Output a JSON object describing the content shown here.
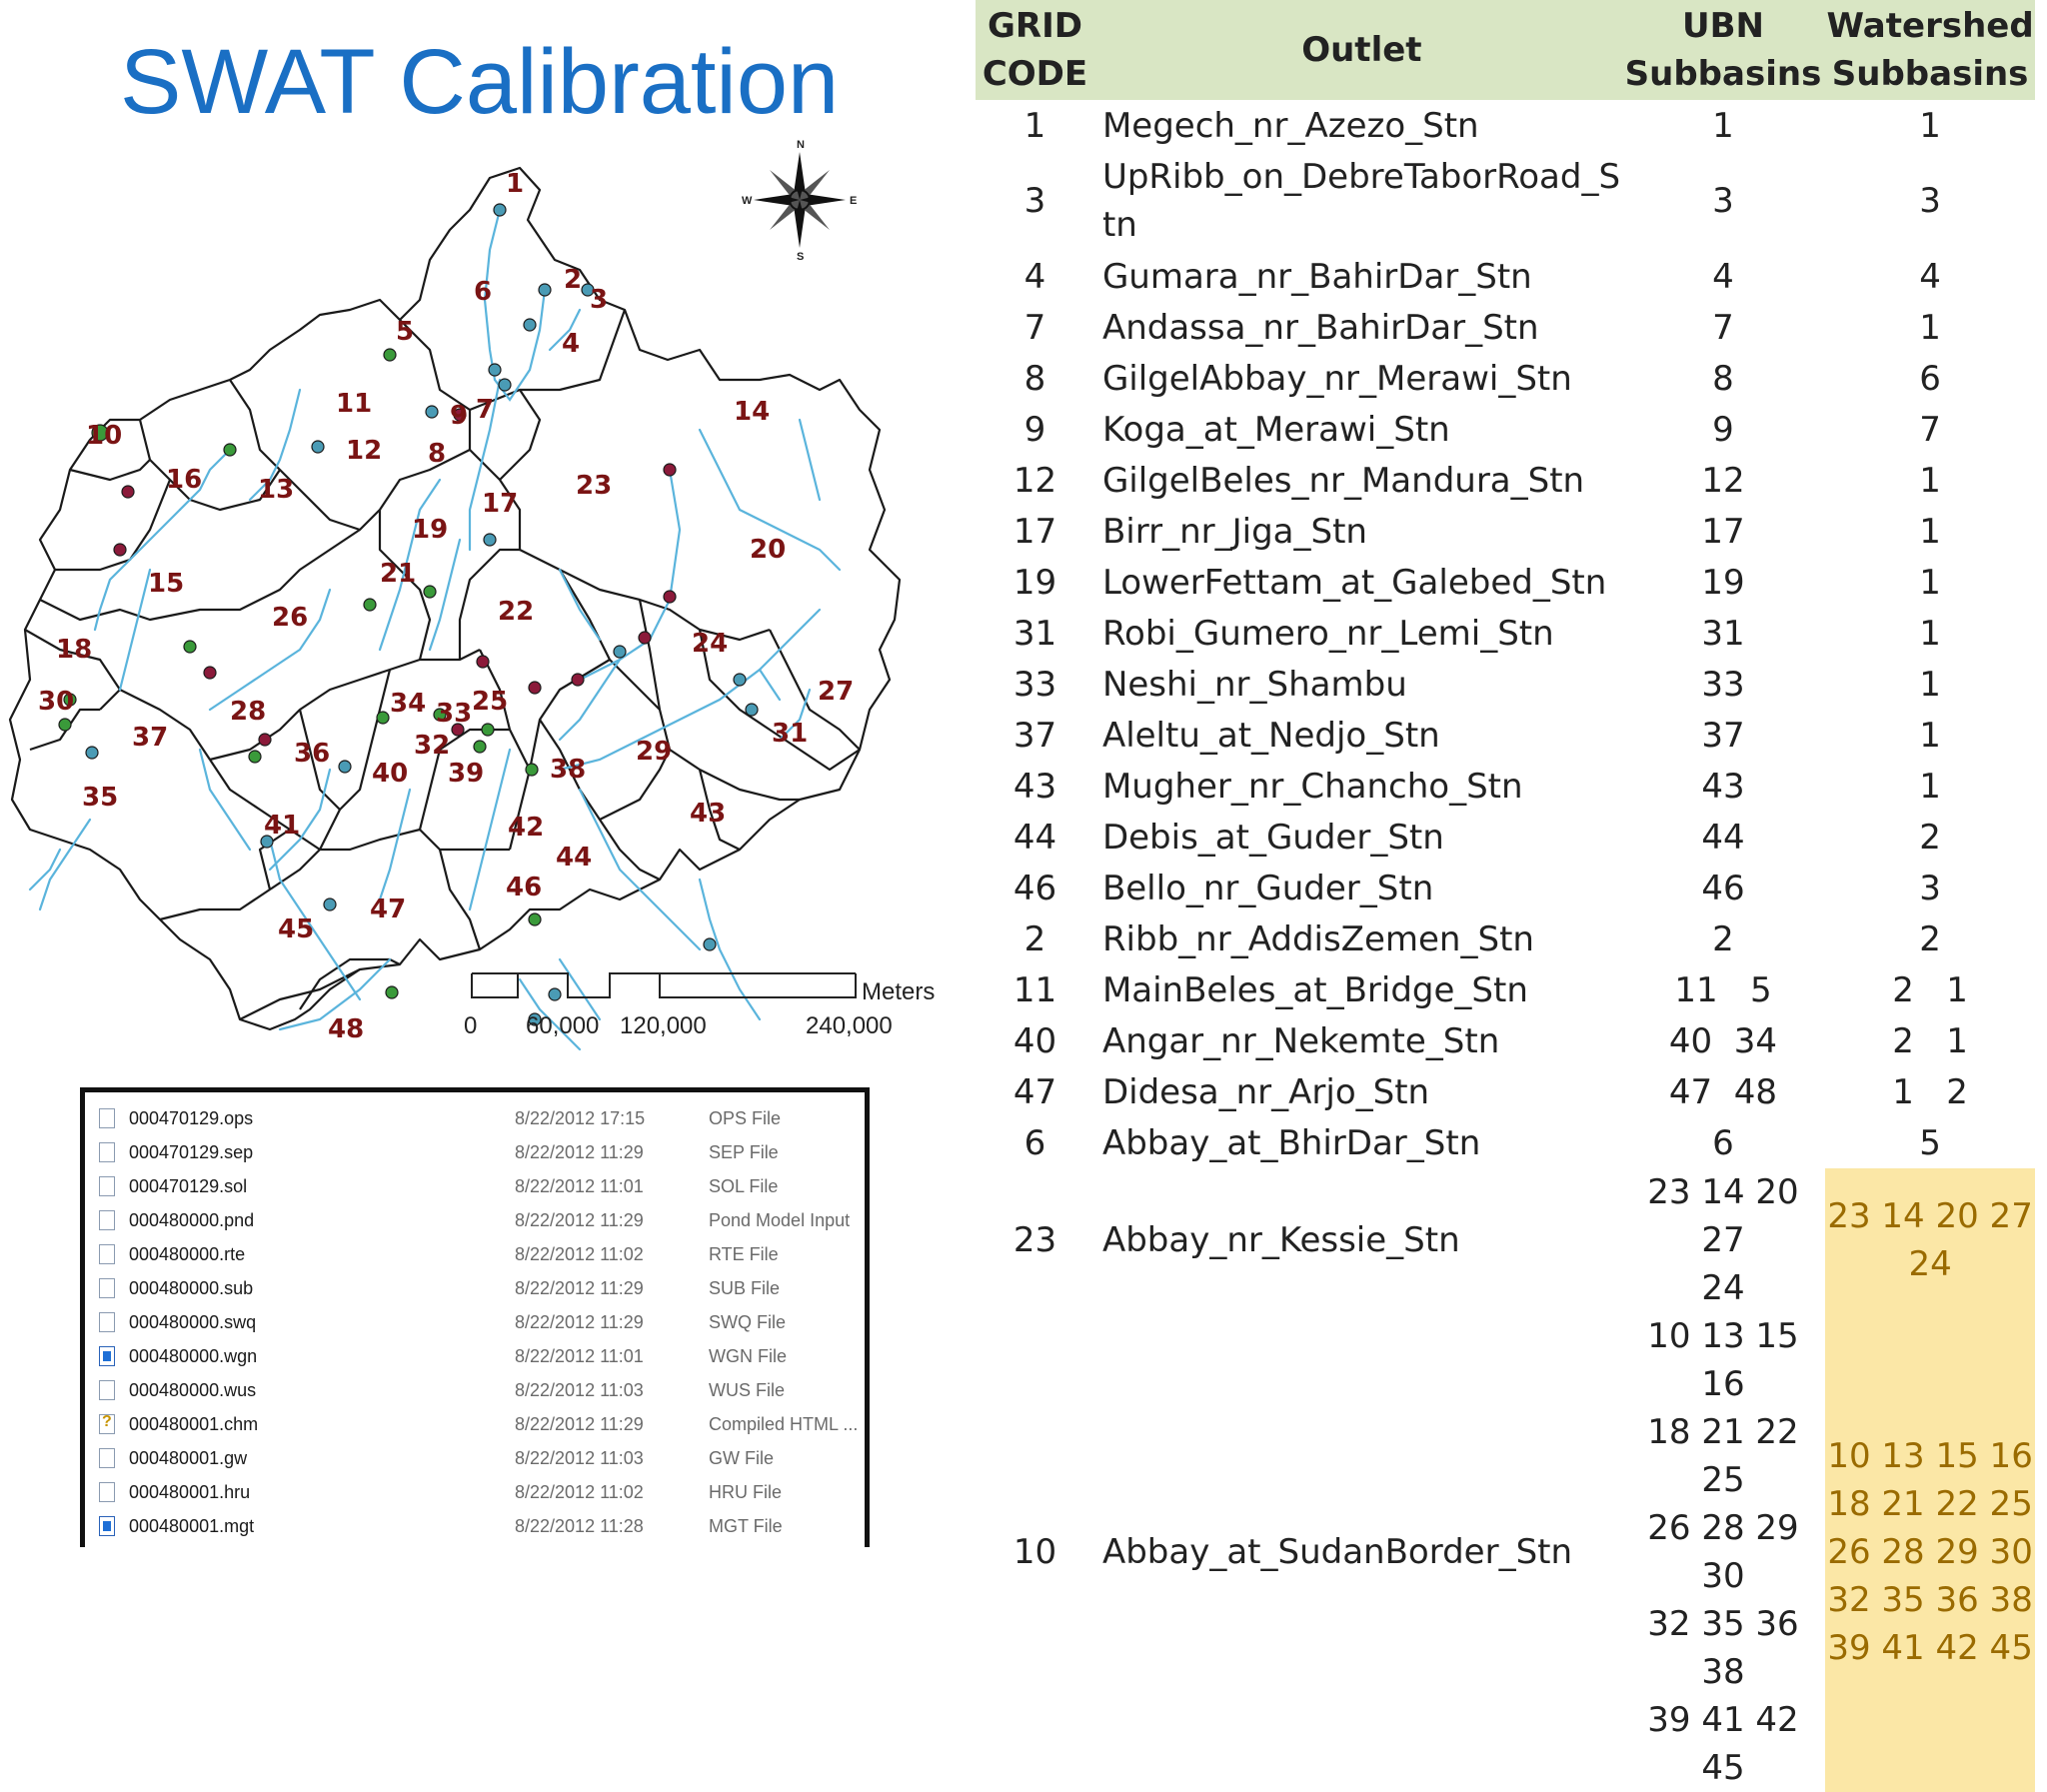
{
  "slide": {
    "title": "SWAT Calibration"
  },
  "map": {
    "subbasin_labels": [
      "1",
      "2",
      "3",
      "4",
      "5",
      "6",
      "7",
      "8",
      "9",
      "10",
      "11",
      "12",
      "13",
      "14",
      "15",
      "16",
      "17",
      "18",
      "19",
      "20",
      "21",
      "22",
      "23",
      "24",
      "25",
      "26",
      "27",
      "28",
      "29",
      "30",
      "31",
      "32",
      "33",
      "34",
      "35",
      "36",
      "37",
      "38",
      "39",
      "40",
      "41",
      "42",
      "43",
      "44",
      "45",
      "46",
      "47",
      "48"
    ],
    "compass": {
      "n": "N",
      "s": "S",
      "e": "E",
      "w": "W"
    },
    "scale_bar": {
      "unit": "Meters",
      "ticks": [
        "0",
        "60,000",
        "120,000",
        "240,000"
      ]
    },
    "colors": {
      "boundary": "#1a1a1a",
      "river": "#5ab4dc",
      "outlet_blue": "#4a9bb5",
      "outlet_green": "#3a9a3a",
      "outlet_red": "#8b1a3a",
      "label": "#7a1414"
    }
  },
  "table": {
    "headers": {
      "code_line1": "GRID",
      "code_line2": "CODE",
      "outlet": "Outlet",
      "ubn_line1": "UBN",
      "ubn_line2": "Subbasins",
      "ws_line1": "Watershed",
      "ws_line2": "Subbasins"
    },
    "rows": [
      {
        "code": "1",
        "outlet": "Megech_nr_Azezo_Stn",
        "ubn": "1",
        "ws": "1"
      },
      {
        "code": "3",
        "outlet": "UpRibb_on_DebreTaborRoad_Stn",
        "ubn": "3",
        "ws": "3"
      },
      {
        "code": "4",
        "outlet": "Gumara_nr_BahirDar_Stn",
        "ubn": "4",
        "ws": "4"
      },
      {
        "code": "7",
        "outlet": "Andassa_nr_BahirDar_Stn",
        "ubn": "7",
        "ws": "1"
      },
      {
        "code": "8",
        "outlet": "GilgelAbbay_nr_Merawi_Stn",
        "ubn": "8",
        "ws": "6"
      },
      {
        "code": "9",
        "outlet": "Koga_at_Merawi_Stn",
        "ubn": "9",
        "ws": "7"
      },
      {
        "code": "12",
        "outlet": "GilgelBeles_nr_Mandura_Stn",
        "ubn": "12",
        "ws": "1"
      },
      {
        "code": "17",
        "outlet": "Birr_nr_Jiga_Stn",
        "ubn": "17",
        "ws": "1"
      },
      {
        "code": "19",
        "outlet": "LowerFettam_at_Galebed_Stn",
        "ubn": "19",
        "ws": "1"
      },
      {
        "code": "31",
        "outlet": "Robi_Gumero_nr_Lemi_Stn",
        "ubn": "31",
        "ws": "1"
      },
      {
        "code": "33",
        "outlet": "Neshi_nr_Shambu",
        "ubn": "33",
        "ws": "1"
      },
      {
        "code": "37",
        "outlet": "Aleltu_at_Nedjo_Stn",
        "ubn": "37",
        "ws": "1"
      },
      {
        "code": "43",
        "outlet": "Mugher_nr_Chancho_Stn",
        "ubn": "43",
        "ws": "1"
      },
      {
        "code": "44",
        "outlet": "Debis_at_Guder_Stn",
        "ubn": "44",
        "ws": "2"
      },
      {
        "code": "46",
        "outlet": "Bello_nr_Guder_Stn",
        "ubn": "46",
        "ws": "3"
      },
      {
        "code": "2",
        "outlet": "Ribb_nr_AddisZemen_Stn",
        "ubn": "2",
        "ws": "2"
      },
      {
        "code": "11",
        "outlet": "MainBeles_at_Bridge_Stn",
        "ubn": "11   5",
        "ws": "2   1"
      },
      {
        "code": "40",
        "outlet": "Angar_nr_Nekemte_Stn",
        "ubn": "40  34",
        "ws": "2   1"
      },
      {
        "code": "47",
        "outlet": "Didesa_nr_Arjo_Stn",
        "ubn": "47  48",
        "ws": "1   2"
      },
      {
        "code": "6",
        "outlet": "Abbay_at_BhirDar_Stn",
        "ubn": "6",
        "ws": "5"
      }
    ],
    "kessie": {
      "code": "23",
      "outlet": "Abbay_nr_Kessie_Stn",
      "ubn_lines": [
        "23 14 20 27",
        "24"
      ],
      "ws_lines": [
        "23 14 20 27",
        "24"
      ]
    },
    "sudan": {
      "code": "10",
      "outlet": "Abbay_at_SudanBorder_Stn",
      "ubn_lines": [
        "10 13 15 16",
        "18 21 22 25",
        "26 28 29 30",
        "32 35 36 38",
        "39 41 42 45"
      ],
      "ws_lines": [
        "10 13 15 16",
        "18 21 22 25",
        "26 28 29 30",
        "32 35 36 38",
        "39 41 42 45"
      ]
    },
    "colors": {
      "header_bg": "#d9e6c4",
      "highlight_bg": "#fbe7a6",
      "highlight_text": "#9a6b00"
    }
  },
  "file_list": {
    "files": [
      {
        "name": "000470129.ops",
        "date": "8/22/2012 17:15",
        "type": "OPS File",
        "icon": "file-icon"
      },
      {
        "name": "000470129.sep",
        "date": "8/22/2012 11:29",
        "type": "SEP File",
        "icon": "file-icon"
      },
      {
        "name": "000470129.sol",
        "date": "8/22/2012 11:01",
        "type": "SOL File",
        "icon": "file-icon"
      },
      {
        "name": "000480000.pnd",
        "date": "8/22/2012 11:29",
        "type": "Pond Model Input",
        "icon": "file-icon"
      },
      {
        "name": "000480000.rte",
        "date": "8/22/2012 11:02",
        "type": "RTE File",
        "icon": "file-icon"
      },
      {
        "name": "000480000.sub",
        "date": "8/22/2012 11:29",
        "type": "SUB File",
        "icon": "file-icon"
      },
      {
        "name": "000480000.swq",
        "date": "8/22/2012 11:29",
        "type": "SWQ File",
        "icon": "file-icon"
      },
      {
        "name": "000480000.wgn",
        "date": "8/22/2012 11:01",
        "type": "WGN File",
        "icon": "wgn-file-icon"
      },
      {
        "name": "000480000.wus",
        "date": "8/22/2012 11:03",
        "type": "WUS File",
        "icon": "file-icon"
      },
      {
        "name": "000480001.chm",
        "date": "8/22/2012 11:29",
        "type": "Compiled HTML ...",
        "icon": "help-file-icon"
      },
      {
        "name": "000480001.gw",
        "date": "8/22/2012 11:03",
        "type": "GW File",
        "icon": "file-icon"
      },
      {
        "name": "000480001.hru",
        "date": "8/22/2012 11:02",
        "type": "HRU File",
        "icon": "file-icon"
      },
      {
        "name": "000480001.mgt",
        "date": "8/22/2012 11:28",
        "type": "MGT File",
        "icon": "wgn-file-icon"
      }
    ]
  }
}
